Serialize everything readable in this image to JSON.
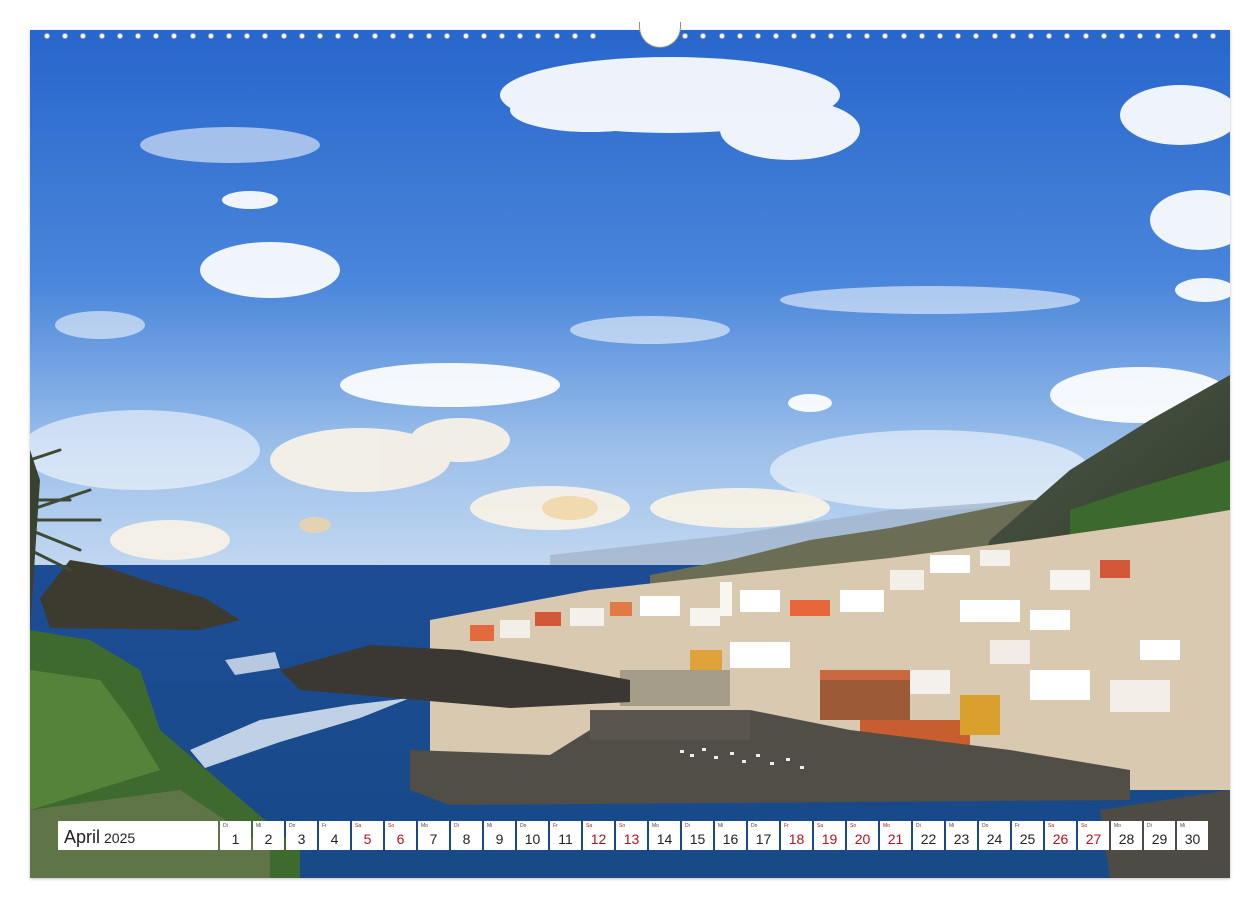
{
  "calendar": {
    "month": "April",
    "year": "2025",
    "days": [
      {
        "wd": "Di",
        "num": "1",
        "red": false
      },
      {
        "wd": "Mi",
        "num": "2",
        "red": false
      },
      {
        "wd": "Do",
        "num": "3",
        "red": false
      },
      {
        "wd": "Fr",
        "num": "4",
        "red": false
      },
      {
        "wd": "Sa",
        "num": "5",
        "red": true
      },
      {
        "wd": "So",
        "num": "6",
        "red": true
      },
      {
        "wd": "Mo",
        "num": "7",
        "red": false
      },
      {
        "wd": "Di",
        "num": "8",
        "red": false
      },
      {
        "wd": "Mi",
        "num": "9",
        "red": false
      },
      {
        "wd": "Do",
        "num": "10",
        "red": false
      },
      {
        "wd": "Fr",
        "num": "11",
        "red": false
      },
      {
        "wd": "Sa",
        "num": "12",
        "red": true
      },
      {
        "wd": "So",
        "num": "13",
        "red": true
      },
      {
        "wd": "Mo",
        "num": "14",
        "red": false
      },
      {
        "wd": "Di",
        "num": "15",
        "red": false
      },
      {
        "wd": "Mi",
        "num": "16",
        "red": false
      },
      {
        "wd": "Do",
        "num": "17",
        "red": false
      },
      {
        "wd": "Fr",
        "num": "18",
        "red": true
      },
      {
        "wd": "Sa",
        "num": "19",
        "red": true
      },
      {
        "wd": "So",
        "num": "20",
        "red": true
      },
      {
        "wd": "Mo",
        "num": "21",
        "red": true
      },
      {
        "wd": "Di",
        "num": "22",
        "red": false
      },
      {
        "wd": "Mi",
        "num": "23",
        "red": false
      },
      {
        "wd": "Do",
        "num": "24",
        "red": false
      },
      {
        "wd": "Fr",
        "num": "25",
        "red": false
      },
      {
        "wd": "Sa",
        "num": "26",
        "red": true
      },
      {
        "wd": "So",
        "num": "27",
        "red": true
      },
      {
        "wd": "Mo",
        "num": "28",
        "red": false
      },
      {
        "wd": "Di",
        "num": "29",
        "red": false
      },
      {
        "wd": "Mi",
        "num": "30",
        "red": false
      }
    ]
  },
  "colors": {
    "holiday_red": "#b3121b",
    "sky_top": "#2f6bd0",
    "sea": "#1f4f9a"
  }
}
